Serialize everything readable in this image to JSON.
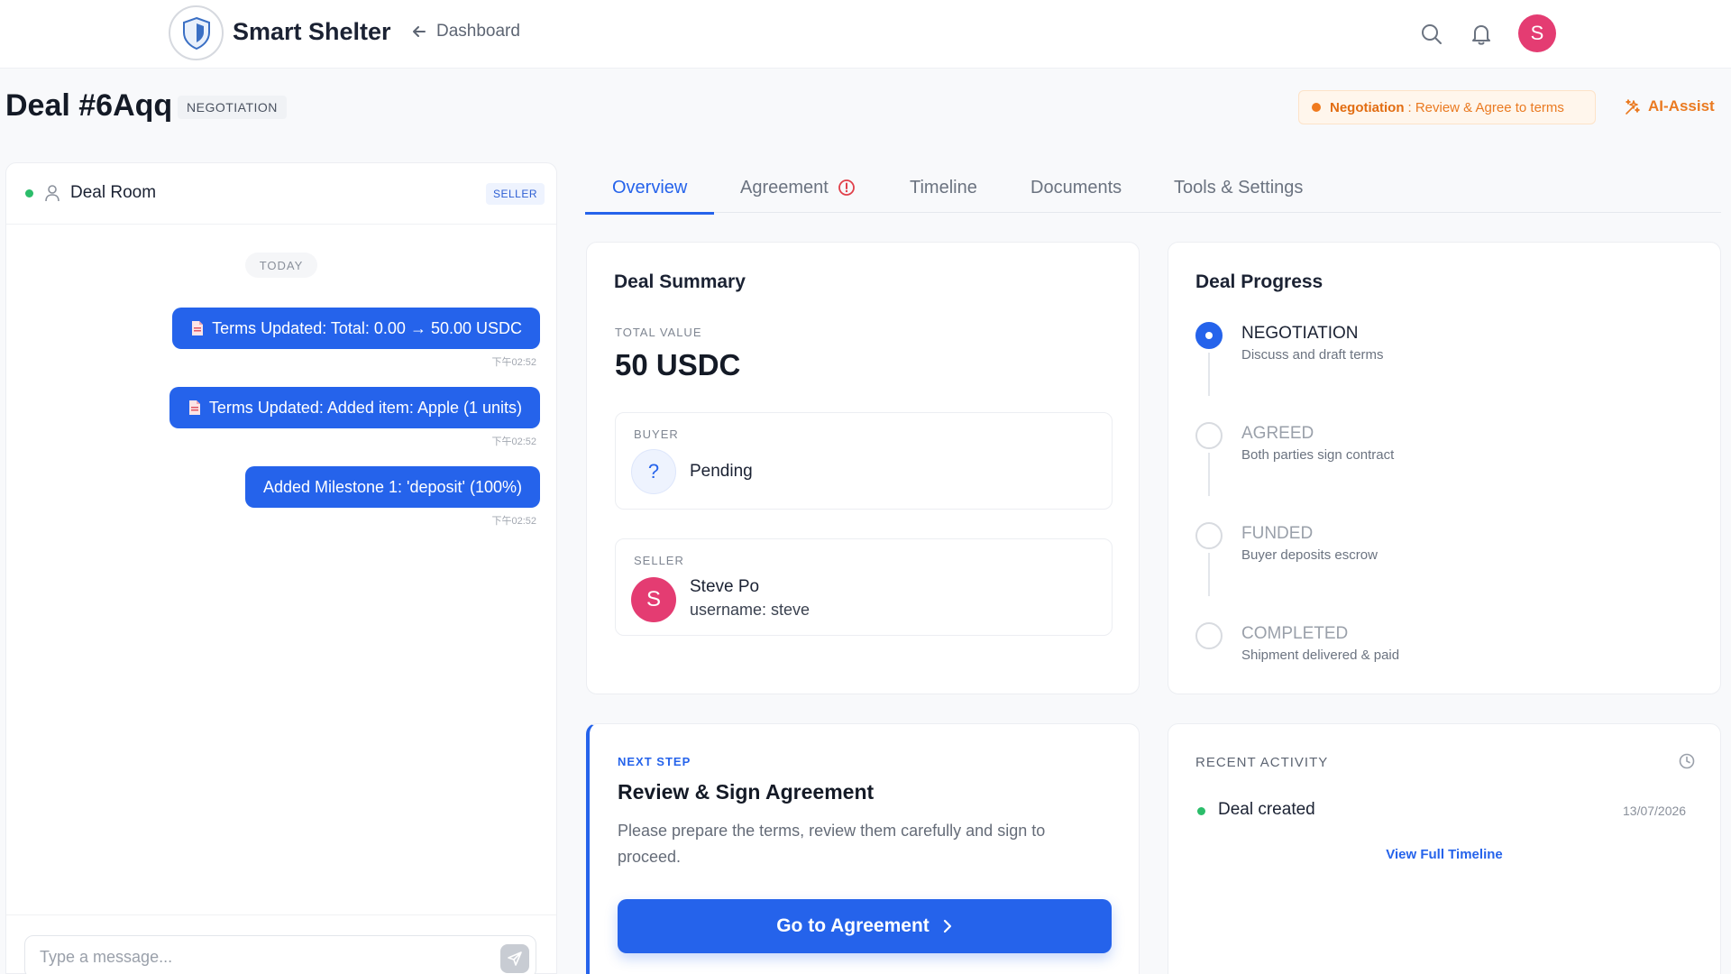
{
  "colors": {
    "primary": "#2563eb",
    "accent_orange": "#ea7a21",
    "avatar": "#e43c72",
    "online": "#2bbd6a"
  },
  "nav": {
    "brand": "Smart Shelter",
    "back_label": "Dashboard",
    "user_initial": "S",
    "icons": [
      "search-icon",
      "bell-icon"
    ]
  },
  "deal": {
    "title": "Deal #6Aqq",
    "status": "NEGOTIATION",
    "stage_label": "Negotiation",
    "stage_detail": ": Review & Agree to terms",
    "ai_assist": "AI-Assist"
  },
  "chat": {
    "title": "Deal Room",
    "role": "SELLER",
    "day": "TODAY",
    "messages": [
      {
        "text": "Terms Updated: Total: 0.00 → 50.00 USDC",
        "time": "下午02:52",
        "icon": "document-icon"
      },
      {
        "text": "Terms Updated: Added item: Apple (1 units)",
        "time": "下午02:52",
        "icon": "document-icon"
      },
      {
        "text": "Added Milestone 1: 'deposit' (100%)",
        "time": "下午02:52",
        "icon": ""
      }
    ],
    "placeholder": "Type a message..."
  },
  "tabs": [
    {
      "label": "Overview",
      "active": true
    },
    {
      "label": "Agreement",
      "alert": true
    },
    {
      "label": "Timeline"
    },
    {
      "label": "Documents"
    },
    {
      "label": "Tools & Settings"
    }
  ],
  "summary": {
    "title": "Deal Summary",
    "total_label": "TOTAL VALUE",
    "total_value": "50 USDC",
    "buyer": {
      "label": "BUYER",
      "avatar": "?",
      "name": "Pending"
    },
    "seller": {
      "label": "SELLER",
      "avatar": "S",
      "name": "Steve Po",
      "username": "username: steve"
    }
  },
  "progress": {
    "title": "Deal Progress",
    "steps": [
      {
        "name": "NEGOTIATION",
        "desc": "Discuss and draft terms",
        "active": true
      },
      {
        "name": "AGREED",
        "desc": "Both parties sign contract"
      },
      {
        "name": "FUNDED",
        "desc": "Buyer deposits escrow"
      },
      {
        "name": "COMPLETED",
        "desc": "Shipment delivered & paid"
      }
    ]
  },
  "next_step": {
    "label": "NEXT STEP",
    "title": "Review & Sign Agreement",
    "desc": "Please prepare the terms, review them carefully and sign to proceed.",
    "button": "Go to Agreement"
  },
  "activity": {
    "label": "RECENT ACTIVITY",
    "items": [
      {
        "text": "Deal created",
        "date": "13/07/2026"
      }
    ],
    "link": "View Full Timeline"
  }
}
